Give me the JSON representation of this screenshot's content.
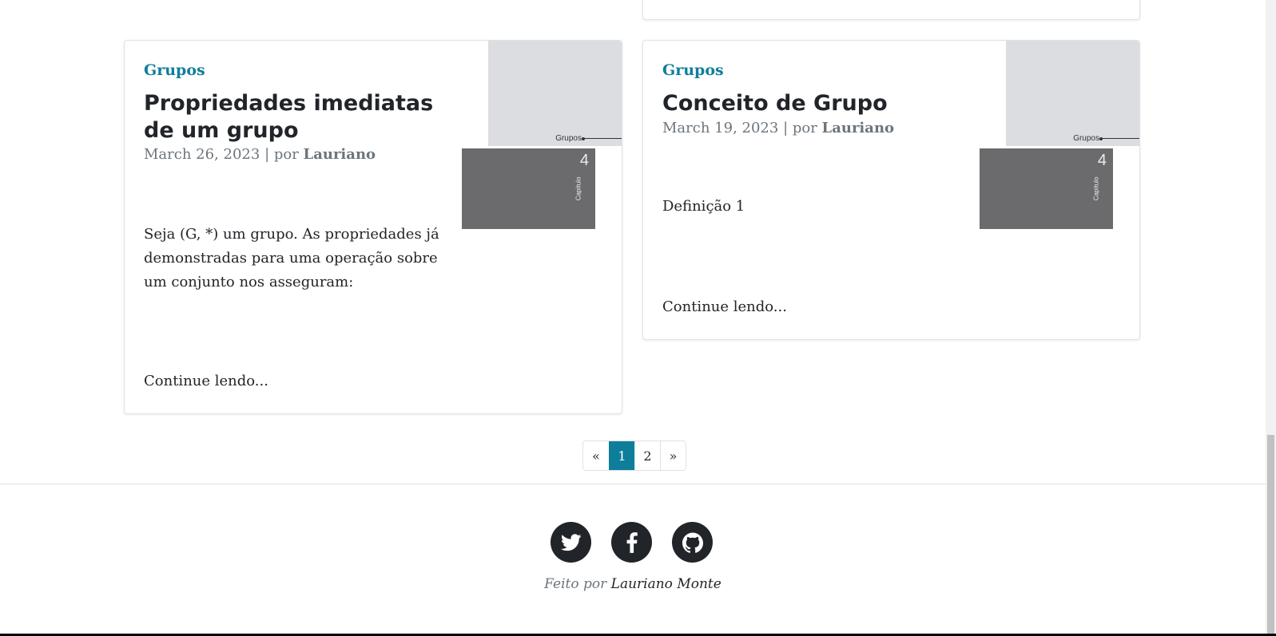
{
  "posts": [
    {
      "category": "Grupos",
      "title": "Propriedades imediatas de um grupo",
      "date": "March 26, 2023",
      "separator": "| por",
      "author": "Lauriano",
      "excerpt": "Seja (G, *) um grupo. As propriedades já demonstradas para uma operação sobre um conjunto nos asseguram:",
      "more_label": "Continue lendo...",
      "thumbnail": {
        "label": "Grupos",
        "chapter_number": "4",
        "chapter_word": "Capítulo"
      }
    },
    {
      "category": "Grupos",
      "title": "Conceito de Grupo",
      "date": "March 19, 2023",
      "separator": "| por",
      "author": "Lauriano",
      "excerpt": "Definição 1",
      "more_label": "Continue lendo...",
      "thumbnail": {
        "label": "Grupos",
        "chapter_number": "4",
        "chapter_word": "Capítulo"
      }
    }
  ],
  "pagination": {
    "prev": "«",
    "pages": [
      "1",
      "2"
    ],
    "active": "1",
    "next": "»"
  },
  "footer": {
    "socials": [
      "twitter-icon",
      "facebook-icon",
      "github-icon"
    ],
    "credit_prefix": "Feito por",
    "credit_name": "Lauriano Monte"
  },
  "colors": {
    "accent": "#0f7e9b",
    "text": "#212529",
    "muted": "#6c757d"
  }
}
